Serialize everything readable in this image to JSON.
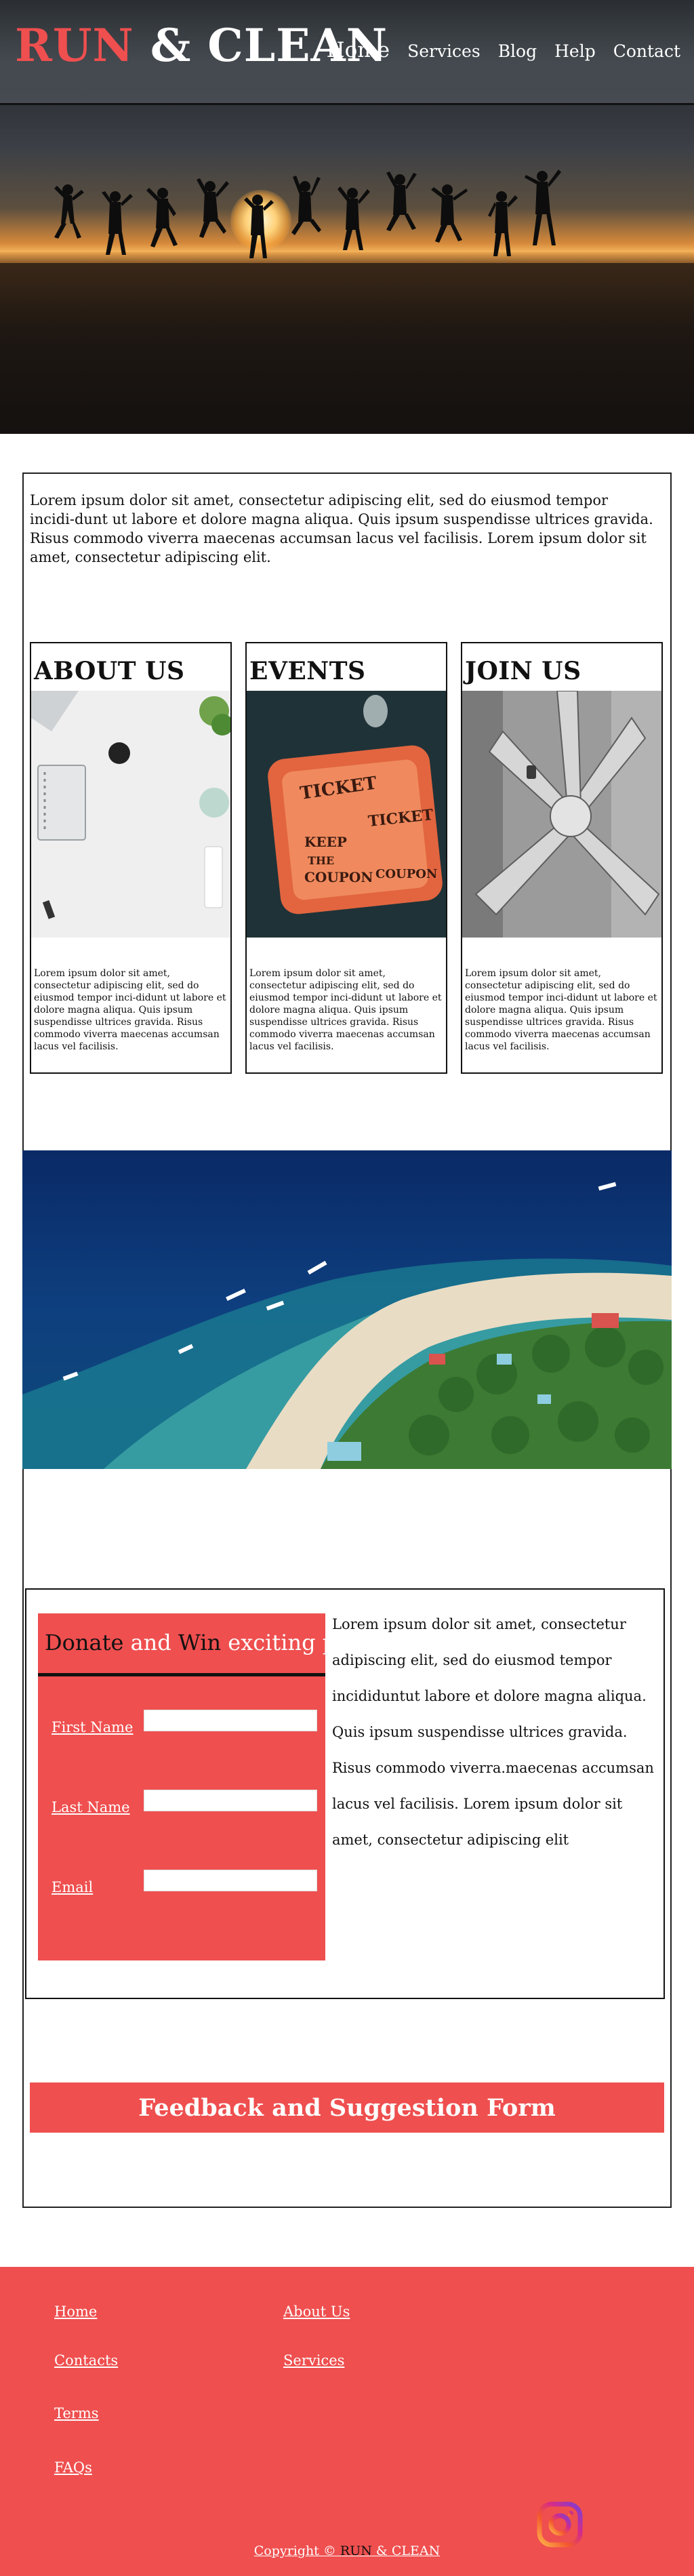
{
  "brand": {
    "logo_run": "RUN",
    "logo_rest": " & CLEAN"
  },
  "nav": {
    "home": "Home",
    "services": "Services",
    "blog": "Blog",
    "help": "Help",
    "contact": "Contact"
  },
  "intro": {
    "text": "Lorem ipsum dolor sit amet, consectetur adipiscing elit, sed do eiusmod tempor incidi-dunt ut labore et dolore magna aliqua. Quis ipsum suspendisse ultrices gravida. Risus commodo viverra maecenas accumsan lacus vel facilisis. Lorem ipsum dolor sit amet, consectetur adipiscing elit."
  },
  "cards": [
    {
      "title": "ABOUT US",
      "text": "Lorem ipsum dolor sit amet, consectetur adipiscing elit, sed do eiusmod tempor inci-didunt ut labore et dolore magna aliqua. Quis ipsum suspendisse ultrices gravida. Risus commodo viverra maecenas accumsan lacus vel facilisis."
    },
    {
      "title": "EVENTS",
      "text": "Lorem ipsum dolor sit amet, consectetur adipiscing elit, sed do eiusmod tempor inci-didunt ut labore et dolore magna aliqua. Quis ipsum suspendisse ultrices gravida. Risus commodo viverra maecenas accumsan lacus vel facilisis."
    },
    {
      "title": "JOIN US",
      "text": "Lorem ipsum dolor sit amet, consectetur adipiscing elit, sed do eiusmod tempor inci-didunt ut labore et dolore magna aliqua. Quis ipsum suspendisse ultrices gravida. Risus commodo viverra maecenas accumsan lacus vel facilisis."
    }
  ],
  "events_photo_text": {
    "ticket": "TICKET",
    "keep": "KEEP",
    "the": "THE",
    "coupon": "COUPON"
  },
  "donate": {
    "title_donate": "Donate",
    "title_and": " and ",
    "title_win": "Win",
    "title_rest": " exciting prices",
    "first_name": "First Name",
    "last_name": "Last Name",
    "email": "Email",
    "side_text": "Lorem ipsum dolor sit amet, consectetur adipiscing elit, sed do eiusmod tempor incididuntut labore et dolore magna aliqua. Quis ipsum suspendisse ultrices gravida. Risus commodo viverra.maecenas accumsan lacus vel facilisis. Lorem ipsum dolor sit amet, consectetur adipiscing elit"
  },
  "feedback": {
    "label": "Feedback and Suggestion Form"
  },
  "footer": {
    "home": "Home",
    "about": "About Us",
    "contacts": "Contacts",
    "services": "Services",
    "terms": "Terms",
    "faqs": "FAQs",
    "copyright_prefix": "Copyright © ",
    "copyright_run": "RUN",
    "copyright_rest": " & CLEAN"
  },
  "colors": {
    "accent": "#ef4f4f",
    "text": "#111111",
    "white": "#ffffff"
  },
  "icons": {
    "social": "instagram-icon"
  }
}
